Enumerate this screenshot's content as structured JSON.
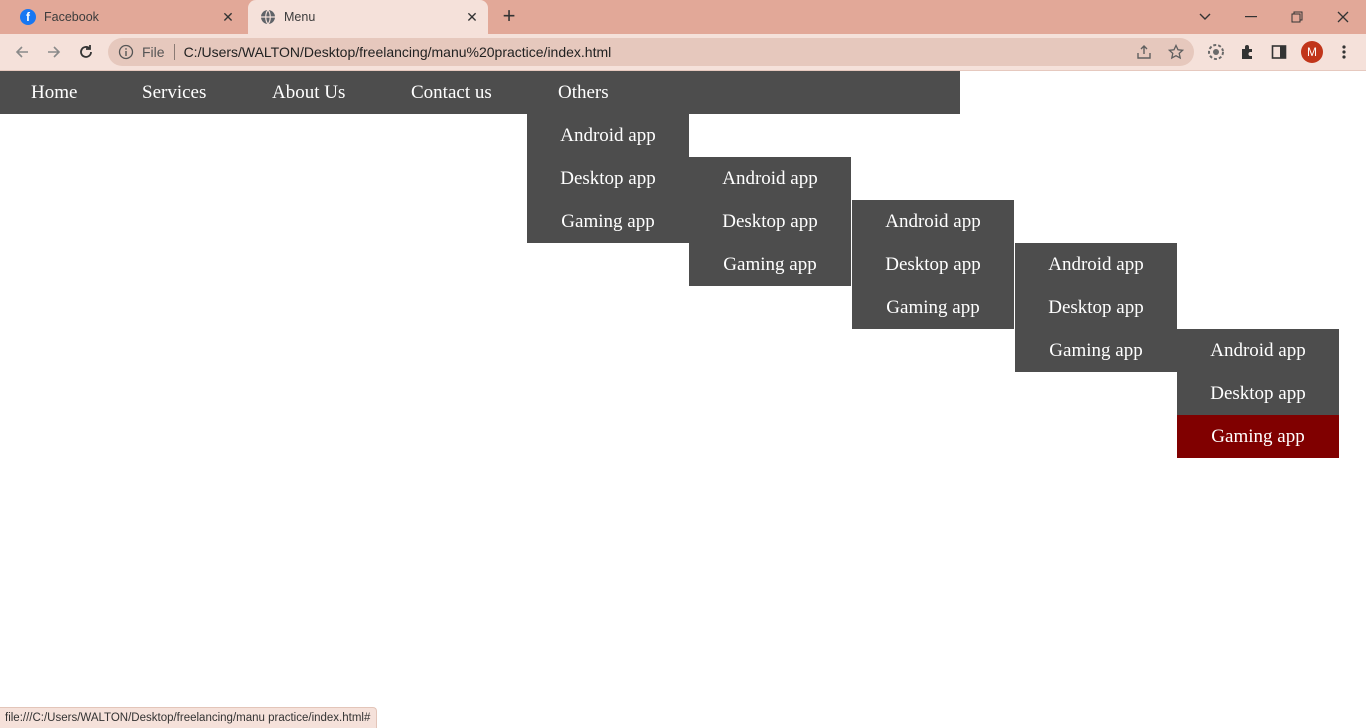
{
  "browser": {
    "tabs": [
      {
        "title": "Facebook",
        "icon": "facebook-icon",
        "active": false
      },
      {
        "title": "Menu",
        "icon": "globe-icon",
        "active": true
      }
    ],
    "address": {
      "scheme_label": "File",
      "url": "C:/Users/WALTON/Desktop/freelancing/manu%20practice/index.html"
    },
    "profile_initial": "M",
    "status_text": "file:///C:/Users/WALTON/Desktop/freelancing/manu practice/index.html#"
  },
  "nav": {
    "items": [
      "Home",
      "Services",
      "About Us",
      "Contact us",
      "Others"
    ]
  },
  "submenus": [
    [
      "Android app",
      "Desktop app",
      "Gaming app"
    ],
    [
      "Android app",
      "Desktop app",
      "Gaming app"
    ],
    [
      "Android app",
      "Desktop app",
      "Gaming app"
    ],
    [
      "Android app",
      "Desktop app",
      "Gaming app"
    ],
    [
      "Android app",
      "Desktop app",
      "Gaming app"
    ]
  ],
  "colors": {
    "menu_bg": "#4d4d4d",
    "menu_hover": "#800000",
    "text": "#ffffff",
    "tab_strip": "#e2a898",
    "toolbar": "#f5e1da"
  }
}
